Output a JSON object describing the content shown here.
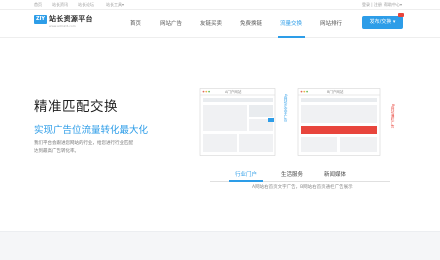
{
  "topbar": {
    "left_links": [
      "首页",
      "站长资讯",
      "站长论坛",
      "站长工具▾"
    ],
    "right_links": [
      "登录 | 注册",
      "帮助中心▾"
    ]
  },
  "header": {
    "logo_icon_text": "ZIY",
    "logo_text": "站长资源平台",
    "logo_subtext": "www.admin5.com",
    "nav": [
      {
        "label": "首页",
        "active": false
      },
      {
        "label": "网站广告",
        "active": false
      },
      {
        "label": "友链买卖",
        "active": false
      },
      {
        "label": "免费换链",
        "active": false
      },
      {
        "label": "流量交换",
        "active": true
      },
      {
        "label": "网站排行",
        "active": false
      }
    ],
    "cta_label": "发布/交换 ▾",
    "accent_color": "#2d9de8"
  },
  "hero": {
    "title": "精准匹配交换",
    "subtitle": "实现广告位流量转化最大化",
    "description_lines": [
      "我们平台会跟进您网站的行业，给您进行行业匹配",
      "达到最高广告转化率。"
    ]
  },
  "illustration": {
    "site_a_label": "A门户网站",
    "site_b_label": "B门户网站",
    "a_note": "A网站左文字广告",
    "b_note": "B网站通栏广告",
    "highlight_color": "#e8453c"
  },
  "tabs": {
    "items": [
      {
        "label": "行业门户",
        "active": true
      },
      {
        "label": "生活服务",
        "active": false
      },
      {
        "label": "新闻媒体",
        "active": false
      }
    ],
    "caption": "A网站右首页文字广告，B网站右首页通栏广告展示"
  }
}
